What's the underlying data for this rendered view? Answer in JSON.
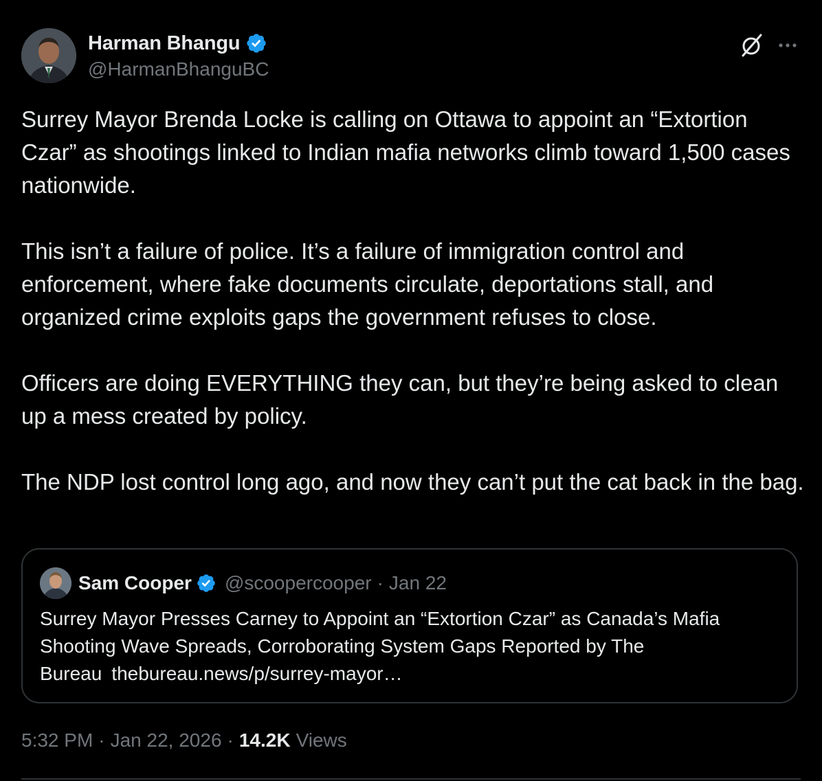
{
  "author": {
    "display_name": "Harman Bhangu",
    "handle": "@HarmanBhanguBC",
    "verified": true
  },
  "icons": {
    "verified": "verified-badge-icon",
    "grok": "grok-icon",
    "more": "more-icon"
  },
  "colors": {
    "verified_blue": "#1d9bf0",
    "background": "#000000",
    "text": "#e7e9ea",
    "muted": "#71767b",
    "border": "#2f3336"
  },
  "tweet": {
    "paragraphs": [
      "Surrey Mayor Brenda Locke is calling on Ottawa to appoint an “Extortion Czar” as shootings linked to Indian mafia networks climb toward 1,500 cases nationwide.",
      "This isn’t a failure of police. It’s a failure of immigration control and enforcement, where fake documents circulate, deportations stall, and organized crime exploits gaps the government refuses to close.",
      "Officers are doing EVERYTHING they can, but they’re being asked to clean up a mess created by policy.",
      "The NDP lost control long ago, and now they can’t put the cat back in the bag."
    ]
  },
  "quote": {
    "display_name": "Sam Cooper",
    "handle": "@scoopercooper",
    "separator": "·",
    "date": "Jan 22",
    "text": "Surrey Mayor Presses Carney to Appoint an “Extortion Czar” as Canada’s Mafia Shooting Wave Spreads, Corroborating System Gaps Reported by The Bureau",
    "link": "thebureau.news/p/surrey-mayor…"
  },
  "meta": {
    "time": "5:32 PM",
    "separator": "·",
    "date": "Jan 22, 2026",
    "views_count": "14.2K",
    "views_label": "Views"
  }
}
